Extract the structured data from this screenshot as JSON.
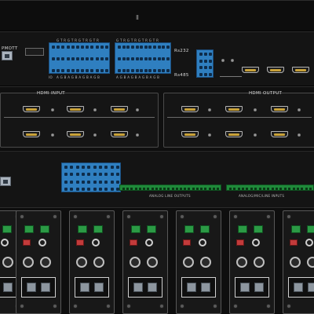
{
  "labels": {
    "hdmi_input": "HDMI INPUT",
    "hdmi_output": "HDMI OUTPUT",
    "rs232": "Rs232",
    "rs485": "Rs485",
    "model_fragment": "PMOTT",
    "analog_line_outputs": "ANALOG LINE OUTPUTS",
    "analog_line_inputs": "ANALOG/MIC/LINE INPUTS",
    "io": "IO",
    "phoenix_top": "G T R G T R G T R G T R",
    "phoenix_bottom": "A G B A G B A G B A G B",
    "top_mark": "Ⅱ"
  },
  "colors": {
    "terminal_blue": "#2f7fc0",
    "terminal_green": "#1f8a3a",
    "hdmi_gold": "#c9a23a",
    "panel_black": "#141414",
    "dip_red": "#c23b3b"
  },
  "modules": {
    "count": 6
  }
}
